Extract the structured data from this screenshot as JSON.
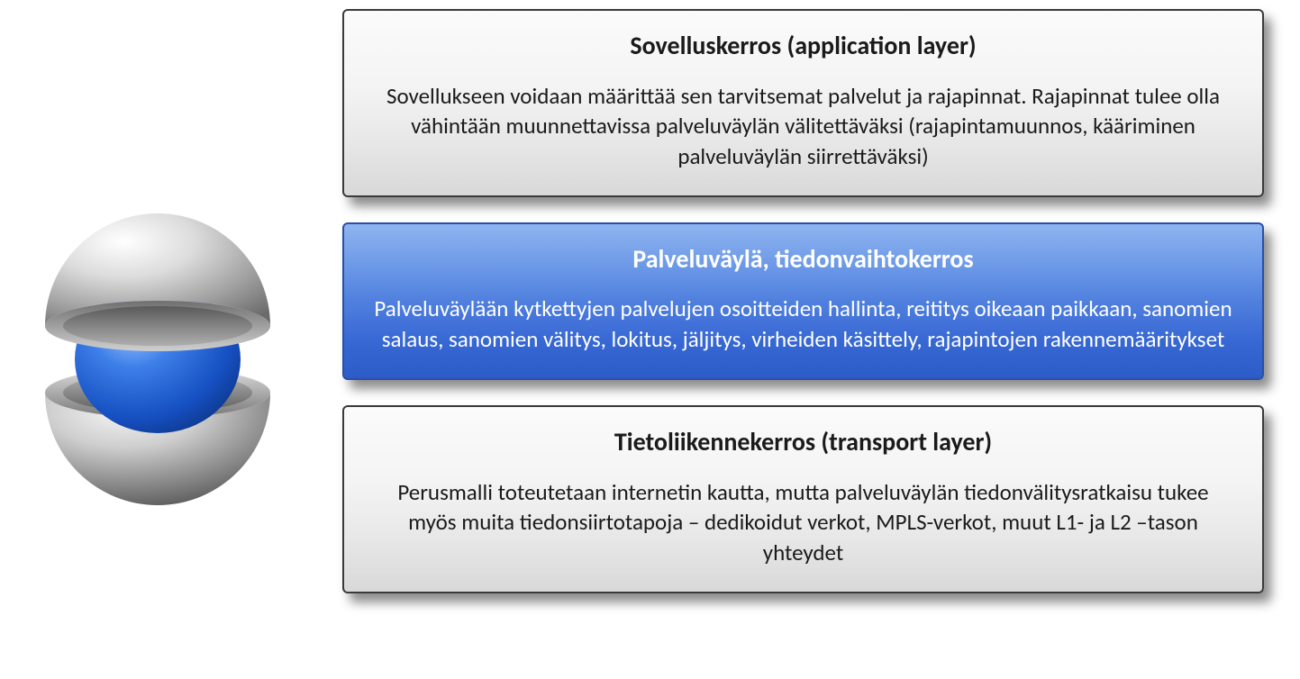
{
  "layers": [
    {
      "title": "Sovelluskerros (application layer)",
      "body": "Sovellukseen voidaan määrittää sen tarvitsemat palvelut ja rajapinnat. Rajapinnat tulee olla vähintään muunnettavissa  palveluväylän välitettäväksi (rajapintamuunnos, kääriminen palveluväylän siirrettäväksi)",
      "variant": "grey"
    },
    {
      "title": "Palveluväylä, tiedonvaihtokerros",
      "body": "Palveluväylään kytkettyjen palvelujen osoitteiden hallinta, reititys oikeaan paikkaan, sanomien salaus, sanomien välitys, lokitus, jäljitys, virheiden käsittely, rajapintojen rakennemääritykset",
      "variant": "blue"
    },
    {
      "title": "Tietoliikennekerros (transport layer)",
      "body": "Perusmalli toteutetaan internetin kautta, mutta palveluväylän tiedonvälitysratkaisu tukee myös muita tiedonsiirtotapoja – dedikoidut verkot, MPLS-verkot, muut L1- ja L2 –tason yhteydet",
      "variant": "grey"
    }
  ]
}
